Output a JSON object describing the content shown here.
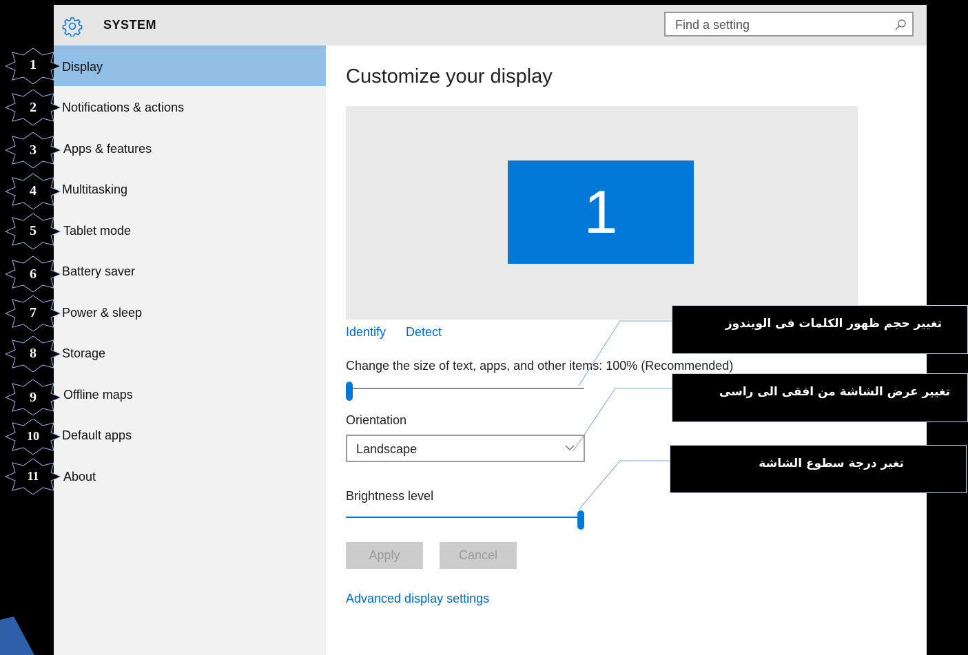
{
  "header": {
    "title": "SYSTEM",
    "search_placeholder": "Find a setting"
  },
  "sidebar": {
    "items": [
      {
        "label": "Display",
        "badge": "1",
        "active": true
      },
      {
        "label": "Notifications & actions",
        "badge": "2"
      },
      {
        "label": "Apps & features",
        "badge": "3"
      },
      {
        "label": "Multitasking",
        "badge": "4"
      },
      {
        "label": "Tablet mode",
        "badge": "5"
      },
      {
        "label": "Battery saver",
        "badge": "6"
      },
      {
        "label": "Power & sleep",
        "badge": "7"
      },
      {
        "label": "Storage",
        "badge": "8"
      },
      {
        "label": "Offline maps",
        "badge": "9"
      },
      {
        "label": "Default apps",
        "badge": "10"
      },
      {
        "label": "About",
        "badge": "11"
      }
    ]
  },
  "main": {
    "title": "Customize your display",
    "monitor_number": "1",
    "identify_link": "Identify",
    "detect_link": "Detect",
    "scale_label": "Change the size of text, apps, and other items: 100% (Recommended)",
    "scale_level": 0,
    "orientation_label": "Orientation",
    "orientation_value": "Landscape",
    "brightness_label": "Brightness level",
    "brightness_level": 100,
    "apply_label": "Apply",
    "cancel_label": "Cancel",
    "advanced_link": "Advanced display settings"
  },
  "callouts": [
    "تغيير حجم ظهور الكلمات فى الويندوز",
    "تغيير عرض الشاشة من افقى الى راسى",
    "تغير درجة سطوع الشاشة"
  ],
  "colors": {
    "accent": "#0078d7",
    "selected_nav": "#91bfe6",
    "link": "#0067c0",
    "badge_fill": "#000000",
    "badge_stroke": "#9db8e0"
  },
  "icons": {
    "settings": "gear-icon",
    "search": "search-icon",
    "dropdown": "chevron-down-icon"
  }
}
